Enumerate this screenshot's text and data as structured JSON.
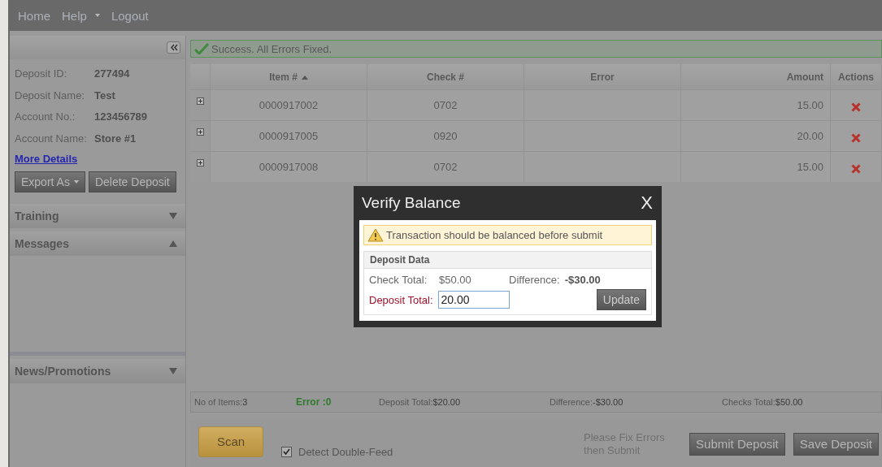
{
  "nav": [
    {
      "label": "Home",
      "has_menu": false
    },
    {
      "label": "Help",
      "has_menu": true
    },
    {
      "label": "Logout",
      "has_menu": false
    }
  ],
  "sidebar": {
    "details": [
      {
        "label": "Deposit ID:",
        "value": "277494"
      },
      {
        "label": "Deposit Name:",
        "value": "Test"
      },
      {
        "label": "Account No.:",
        "value": "123456789"
      },
      {
        "label": "Account Name:",
        "value": "Store #1"
      }
    ],
    "more_link": "More Details",
    "buttons": [
      {
        "label": "Export As",
        "has_menu": true
      },
      {
        "label": "Delete Deposit",
        "has_menu": false
      }
    ],
    "panels": [
      {
        "title": "Training",
        "expanded": false
      },
      {
        "title": "Messages",
        "expanded": true
      },
      {
        "title": "News/Promotions",
        "expanded": false
      }
    ]
  },
  "success_message": "Success. All Errors Fixed.",
  "table": {
    "columns": [
      {
        "label": "Item #",
        "sorted": true
      },
      {
        "label": "Check #",
        "sorted": false
      },
      {
        "label": "Error",
        "sorted": false
      },
      {
        "label": "Amount",
        "sorted": false
      },
      {
        "label": "Actions",
        "sorted": false
      }
    ],
    "rows": [
      {
        "item": "0000917002",
        "check": "0702",
        "amount": "15.00"
      },
      {
        "item": "0000917005",
        "check": "0920",
        "amount": "20.00"
      },
      {
        "item": "0000917008",
        "check": "0702",
        "amount": "15.00"
      }
    ]
  },
  "status_bar": [
    {
      "label": "No of Items:",
      "value": "3",
      "kind": "plain"
    },
    {
      "label": "Error :0",
      "kind": "error"
    },
    {
      "label": "Deposit Total:",
      "value": "$20.00",
      "kind": "plain"
    },
    {
      "label": "Difference:",
      "value": "-$30.00",
      "kind": "plain"
    },
    {
      "label": "Checks Total:",
      "value": "$50.00",
      "kind": "plain"
    }
  ],
  "footer": {
    "scan": "Scan",
    "detect_double_feed": {
      "label": "Detect Double-Feed",
      "checked": true
    },
    "hint": "Please Fix Errors then Submit",
    "buttons": [
      "Submit Deposit",
      "Save Deposit"
    ]
  },
  "dialog": {
    "title": "Verify Balance",
    "close": "X",
    "warning": "Transaction should be balanced before submit",
    "section": "Deposit Data",
    "check_total_label": "Check Total:",
    "check_total": "$50.00",
    "difference_label": "Difference:",
    "difference": "-$30.00",
    "deposit_total_label": "Deposit Total:",
    "deposit_total": "20.00",
    "update": "Update"
  }
}
